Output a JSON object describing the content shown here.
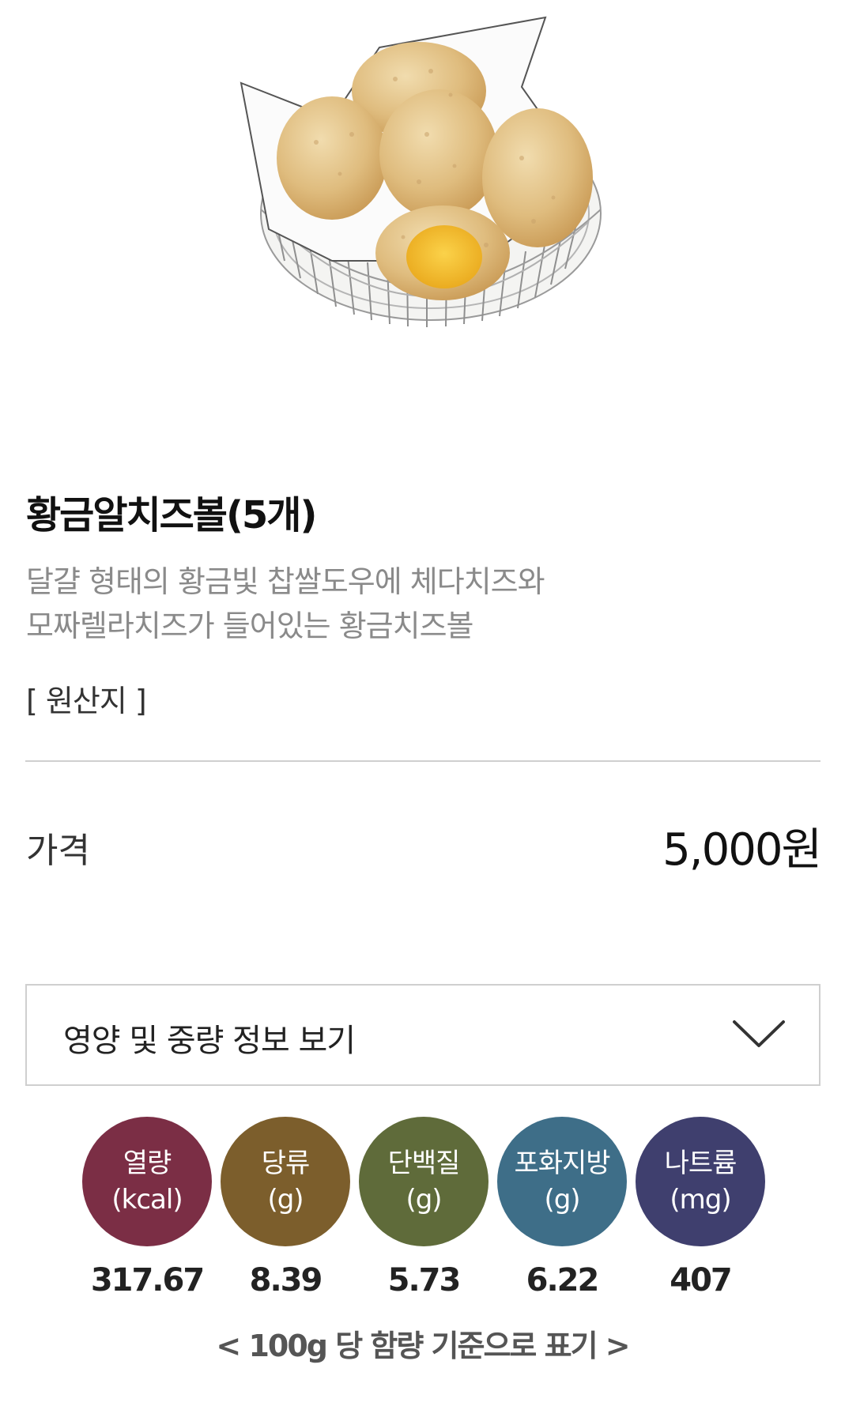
{
  "product": {
    "image_icon": "cheese-ball-basket-image",
    "name": "황금알치즈볼(5개)",
    "description_lines": [
      "달걀 형태의 황금빛 찹쌀도우에 체다치즈와",
      "모짜렐라치즈가 들어있는 황금치즈볼"
    ],
    "origin_label": "[ 원산지 ]"
  },
  "price": {
    "label": "가격",
    "value": "5,000원"
  },
  "nutrition_toggle": {
    "label": "영양 및 중량 정보 보기",
    "icon": "chevron-down-icon"
  },
  "nutrition": [
    {
      "name": "열량",
      "unit": "(kcal)",
      "value": "317.67",
      "color": "#7b2e45"
    },
    {
      "name": "당류",
      "unit": "(g)",
      "value": "8.39",
      "color": "#7c5e2c"
    },
    {
      "name": "단백질",
      "unit": "(g)",
      "value": "5.73",
      "color": "#5f6b3a"
    },
    {
      "name": "포화지방",
      "unit": "(g)",
      "value": "6.22",
      "color": "#3e6e88"
    },
    {
      "name": "나트륨",
      "unit": "(mg)",
      "value": "407",
      "color": "#3f3f6e"
    }
  ],
  "footnote": "< 100g 당 함량 기준으로 표기 >"
}
